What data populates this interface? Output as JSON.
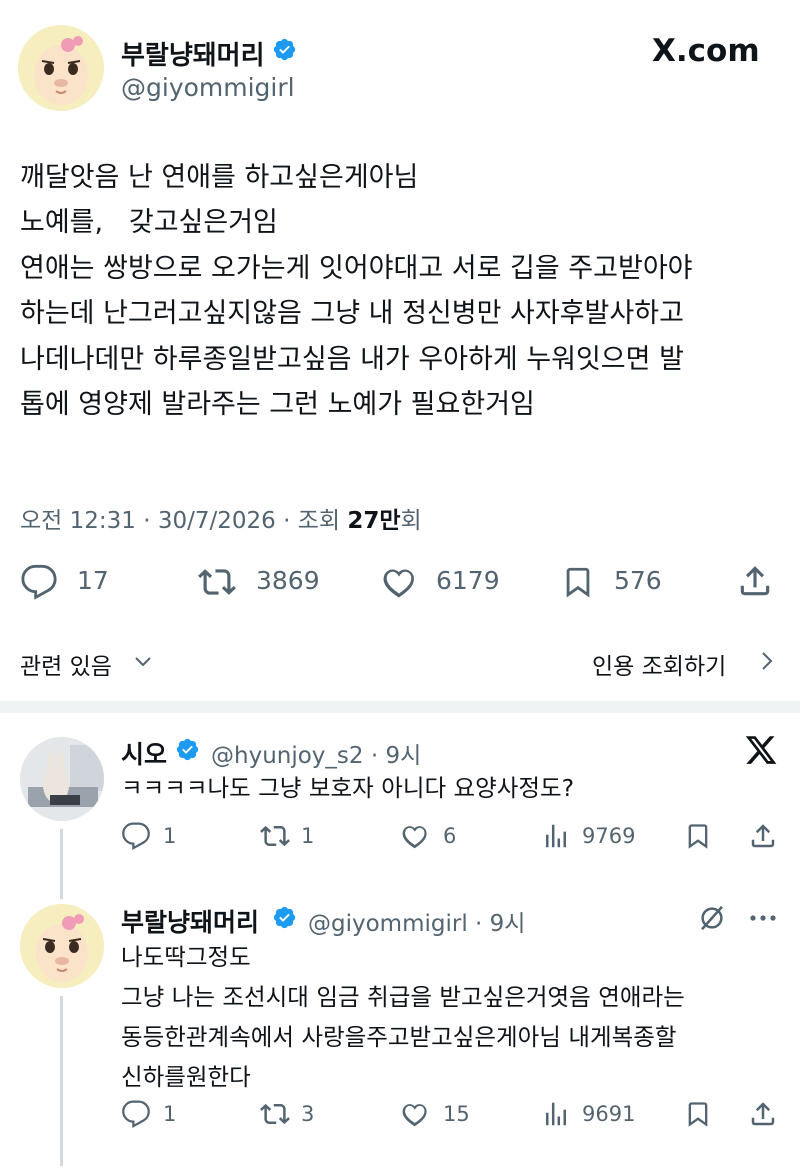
{
  "tweet": {
    "author_name": "부랄냥돼머리",
    "author_handle": "@giyommigirl",
    "site": "X.com",
    "lines": [
      "깨달앗음 난 연애를 하고싶은게아님",
      "노예를,   갖고싶은거임",
      "연애는 쌍방으로 오가는게 잇어야대고 서로 깁을 주고받아야",
      "하는데 난그러고싶지않음 그냥 내 정신병만 사자후발사하고",
      "나데나데만 하루종일받고싶음 내가 우아하게 누워잇으면 발",
      "톱에 영양제 발라주는 그런 노예가 필요한거임"
    ],
    "meta_prefix": "오전 12:31 · 30/7/2026 · 조회 ",
    "meta_views": "27만",
    "meta_suffix": "회",
    "actions": {
      "replies": "17",
      "reposts": "3869",
      "likes": "6179",
      "bookmarks": "576"
    },
    "related_label": "관련 있음",
    "quotes_label": "인용 조회하기"
  },
  "replies": [
    {
      "name": "시오",
      "handle": "@hyunjoy_s2",
      "time": "· 9시",
      "lines": [
        "ㅋㅋㅋㅋ나도 그냥 보호자 아니다 요양사정도?"
      ],
      "replies": "1",
      "reposts": "1",
      "likes": "6",
      "views": "9769"
    },
    {
      "name": "부랄냥돼머리",
      "handle": "@giyommigirl",
      "time": "· 9시",
      "lines": [
        "나도딱그정도",
        "그냥 나는 조선시대 임금 취급을 받고싶은거엿음 연애라는",
        "동등한관계속에서 사랑을주고받고싶은게아님 내게복종할",
        "신하를원한다"
      ],
      "replies": "1",
      "reposts": "3",
      "likes": "15",
      "views": "9691"
    }
  ],
  "icons": {
    "verified": "verified-badge-icon",
    "reply": "reply-icon",
    "repost": "repost-icon",
    "like": "like-icon",
    "bookmark": "bookmark-icon",
    "share": "share-icon",
    "views": "views-icon",
    "x_logo": "x-logo-icon",
    "grok": "grok-icon",
    "more": "more-icon",
    "chevron_down": "chevron-down-icon",
    "chevron_right": "chevron-right-icon"
  },
  "colors": {
    "verified_blue": "#1d9bf0",
    "text_primary": "#0f1419",
    "text_secondary": "#536471",
    "divider": "#eff3f4"
  }
}
